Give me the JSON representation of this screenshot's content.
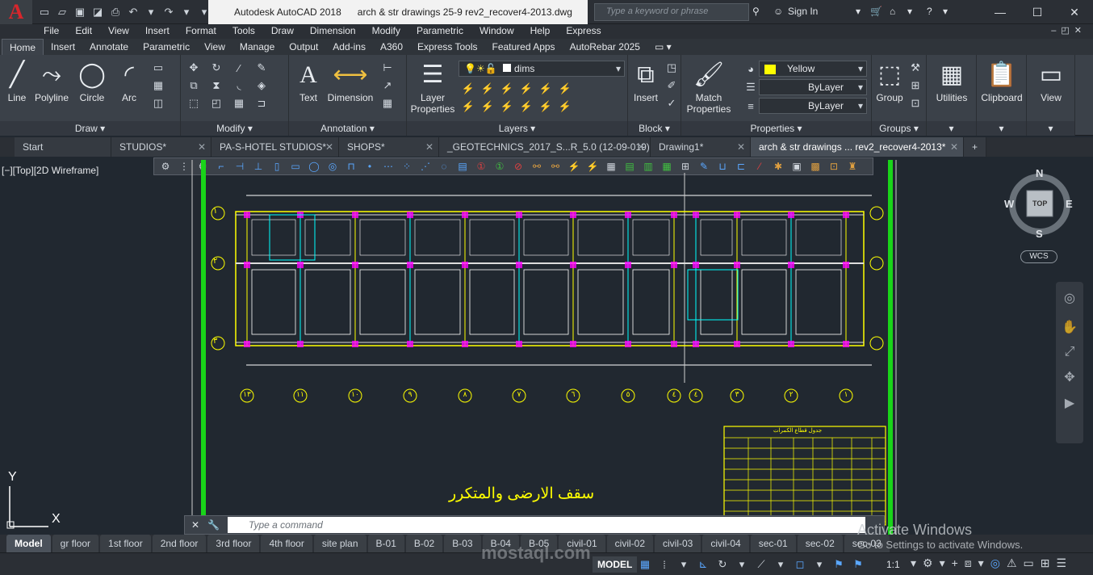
{
  "app": {
    "title_app": "Autodesk AutoCAD 2018",
    "title_file": "arch & str drawings 25-9 rev2_recover4-2013.dwg",
    "logo": "A"
  },
  "search": {
    "placeholder": "Type a keyword or phrase"
  },
  "signin": "Sign In",
  "menu": [
    "File",
    "Edit",
    "View",
    "Insert",
    "Format",
    "Tools",
    "Draw",
    "Dimension",
    "Modify",
    "Parametric",
    "Window",
    "Help",
    "Express"
  ],
  "ribbon_tabs": [
    "Home",
    "Insert",
    "Annotate",
    "Parametric",
    "View",
    "Manage",
    "Output",
    "Add-ins",
    "A360",
    "Express Tools",
    "Featured Apps",
    "AutoRebar 2025"
  ],
  "panels": {
    "draw": {
      "title": "Draw",
      "line": "Line",
      "polyline": "Polyline",
      "circle": "Circle",
      "arc": "Arc"
    },
    "modify": {
      "title": "Modify"
    },
    "annotation": {
      "title": "Annotation",
      "text": "Text",
      "dimension": "Dimension"
    },
    "layers": {
      "title": "Layers",
      "layer_properties": "Layer Properties",
      "current_layer": "dims"
    },
    "block": {
      "title": "Block",
      "insert": "Insert"
    },
    "properties": {
      "title": "Properties",
      "match": "Match Properties",
      "color": "Yellow",
      "linetype": "ByLayer",
      "lineweight": "ByLayer"
    },
    "groups": {
      "title": "Groups",
      "group": "Group"
    },
    "utilities": {
      "title": "Utilities"
    },
    "clipboard": {
      "title": "Clipboard"
    },
    "view": {
      "title": "View"
    }
  },
  "file_tabs": [
    "Start",
    "STUDIOS*",
    "PA-S-HOTEL STUDIOS*",
    "SHOPS*",
    "_GEOTECHNICS_2017_S...R_5.0 (12-09-019)*",
    "Drawing1*",
    "arch & str drawings ... rev2_recover4-2013*"
  ],
  "viewport": {
    "label": "[−][Top][2D Wireframe]",
    "compass": {
      "n": "N",
      "s": "S",
      "e": "E",
      "w": "W",
      "top": "TOP"
    },
    "wcs": "WCS",
    "ucs_x": "X",
    "ucs_y": "Y"
  },
  "drawing": {
    "row_markers": [
      "١",
      "٢",
      "٣"
    ],
    "col_markers": [
      "١٣",
      "١١",
      "١٠",
      "٩",
      "٨",
      "٧",
      "٦",
      "٥",
      "٤",
      "٤",
      "٣",
      "٢",
      "١"
    ],
    "caption": "سقف الارضى والمتكرر",
    "table_title": "جدول قطاع الكمرات"
  },
  "command": {
    "placeholder": "Type a command"
  },
  "layout_tabs": [
    "Model",
    "gr floor",
    "1st floor",
    "2nd floor",
    "3rd floor",
    "4th floor",
    "site plan",
    "B-01",
    "B-02",
    "B-03",
    "B-04",
    "B-05",
    "civil-01",
    "civil-02",
    "civil-03",
    "civil-04",
    "sec-01",
    "sec-02",
    "sec-03"
  ],
  "status": {
    "model": "MODEL",
    "scale": "1:1"
  },
  "watermark": {
    "line1": "Activate Windows",
    "line2": "Go to Settings to activate Windows."
  },
  "mostaql": "mostaql.com",
  "colors": {
    "accent": "#2d8ccc",
    "drawing_yellow": "#ffff00",
    "grid_green": "#19d419",
    "cyan": "#00ffff",
    "magenta": "#ff00ff"
  }
}
